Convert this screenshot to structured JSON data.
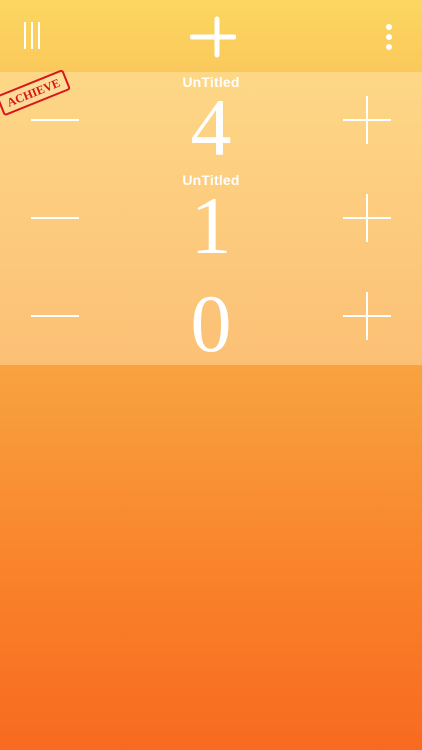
{
  "topbar": {
    "menu_icon": "vertical-lines-icon",
    "add_icon": "plus-icon",
    "more_icon": "vertical-dots-icon"
  },
  "stamp": {
    "label": "ACHIEVE"
  },
  "counters": [
    {
      "title": "UnTitled",
      "value": "4"
    },
    {
      "title": "UnTitled",
      "value": "1"
    },
    {
      "title": "",
      "value": "0"
    }
  ],
  "colors": {
    "top": "#fbd760",
    "bottom": "#f86a20",
    "foreground": "#ffffff",
    "stamp": "#d6171b"
  }
}
